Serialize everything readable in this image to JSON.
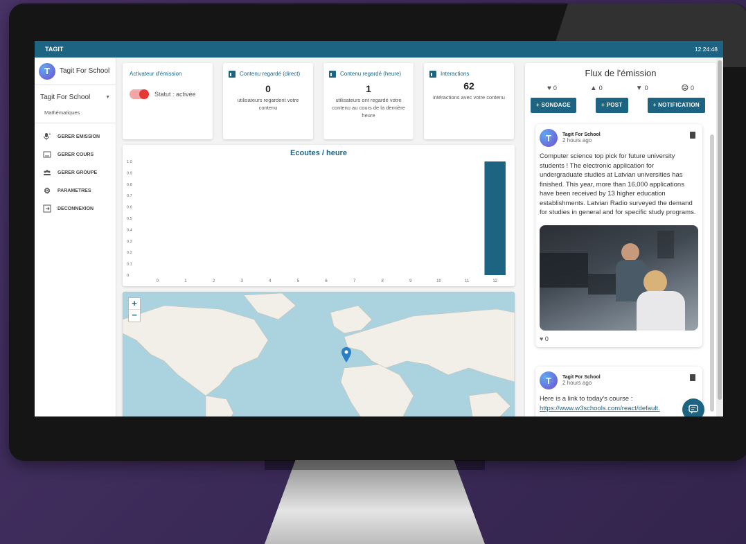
{
  "app": {
    "title": "TAGIT",
    "clock": "12:24:48"
  },
  "sidebar": {
    "brand": "Tagit For School",
    "select_value": "Tagit For School",
    "subject": "Mathématiques",
    "items": [
      {
        "label": "GERER EMISSION",
        "icon": "microphone-icon"
      },
      {
        "label": "GERER COURS",
        "icon": "board-icon"
      },
      {
        "label": "GERER GROUPE",
        "icon": "group-icon"
      },
      {
        "label": "PARAMETRES",
        "icon": "gear-icon"
      },
      {
        "label": "DECONNEXION",
        "icon": "logout-icon"
      }
    ]
  },
  "cards": {
    "activator": {
      "title": "Activateur d'émission",
      "status": "Statut : activée"
    },
    "direct": {
      "title": "Contenu regardé (direct)",
      "value": "0",
      "text": "utilisateurs regardent votre contenu"
    },
    "hour": {
      "title": "Contenu regardé (heure)",
      "value": "1",
      "text": "utilisateurs ont regardé votre contenu au cours de la dernière heure"
    },
    "interactions": {
      "title": "Interactions",
      "value": "62",
      "text": "intéractions avec votre contenu"
    }
  },
  "chart_data": {
    "type": "bar",
    "title": "Ecoutes / heure",
    "categories": [
      "0",
      "1",
      "2",
      "3",
      "4",
      "5",
      "6",
      "7",
      "8",
      "9",
      "10",
      "11",
      "12"
    ],
    "values": [
      0,
      0,
      0,
      0,
      0,
      0,
      0,
      0,
      0,
      0,
      0,
      0,
      1
    ],
    "ylim": [
      0,
      1.0
    ],
    "yticks": [
      "1.0",
      "0.9",
      "0.8",
      "0.7",
      "0.6",
      "0.5",
      "0.4",
      "0.3",
      "0.2",
      "0.1",
      "0"
    ],
    "color": "#1d6483"
  },
  "map": {
    "zoom_in": "+",
    "zoom_out": "−"
  },
  "feed": {
    "title": "Flux de l'émission",
    "reactions": [
      {
        "icon": "heart-icon",
        "count": "0"
      },
      {
        "icon": "thumbs-up-icon",
        "count": "0"
      },
      {
        "icon": "thumbs-down-icon",
        "count": "0"
      },
      {
        "icon": "angry-face-icon",
        "count": "0"
      }
    ],
    "buttons": [
      "+ SONDAGE",
      "+ POST",
      "+ NOTIFICATION"
    ],
    "posts": [
      {
        "author": "Tagit For School",
        "time": "2 hours ago",
        "text": "Computer science top pick for future university students ! The electronic application for undergraduate studies at Latvian universities has finished. This year, more than 16,000 applications have been received by 13 higher education establishments. Latvian Radio surveyed the demand for studies in general and for specific study programs.",
        "likes": "0"
      },
      {
        "author": "Tagit For School",
        "time": "2 hours ago",
        "text": "Here is a link to today's course :",
        "link": "https://www.w3schools.com/react/default."
      }
    ]
  },
  "colors": {
    "primary": "#1d6483",
    "toggle_on": "#e53935"
  }
}
